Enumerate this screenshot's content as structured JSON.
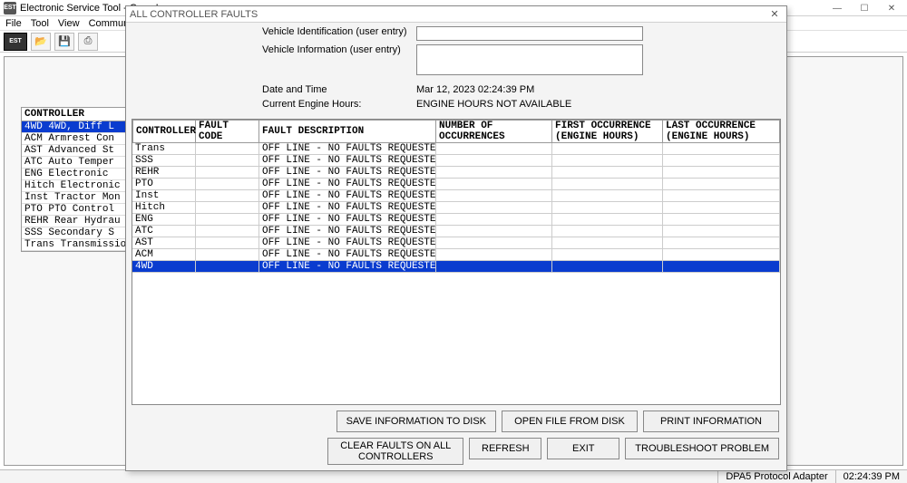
{
  "mainWindow": {
    "title": "Electronic Service Tool - Case I",
    "appIconLabel": "EST",
    "menu": [
      "File",
      "Tool",
      "View",
      "Communicati"
    ],
    "sysButtons": {
      "min": "—",
      "max": "☐",
      "close": "✕"
    },
    "toolbar": {
      "estLabel": "EST",
      "openIcon": "📂",
      "saveIcon": "💾",
      "printIcon": "⎙"
    }
  },
  "controllerList": {
    "header": "CONTROLLER",
    "rows": [
      {
        "text": "4WD   4WD, Diff L",
        "selected": true
      },
      {
        "text": "ACM   Armrest Con",
        "selected": false
      },
      {
        "text": "AST   Advanced St",
        "selected": false
      },
      {
        "text": "ATC   Auto Temper",
        "selected": false
      },
      {
        "text": "ENG   Electronic ",
        "selected": false
      },
      {
        "text": "Hitch Electronic ",
        "selected": false
      },
      {
        "text": "Inst  Tractor Mon",
        "selected": false
      },
      {
        "text": "PTO   PTO Control",
        "selected": false
      },
      {
        "text": "REHR  Rear Hydrau",
        "selected": false
      },
      {
        "text": "SSS   Secondary S",
        "selected": false
      },
      {
        "text": "Trans Transmissio",
        "selected": false
      }
    ]
  },
  "statusBar": {
    "adapter": "DPA5 Protocol Adapter",
    "clock": "02:24:39 PM"
  },
  "dialog": {
    "title": "ALL CONTROLLER FAULTS",
    "labels": {
      "vehId": "Vehicle Identification (user entry)",
      "vehInfo": "Vehicle Information (user entry)",
      "dateTime": "Date and Time",
      "engHours": "Current Engine Hours:"
    },
    "values": {
      "vehId": "",
      "vehInfo": "",
      "dateTime": "Mar 12, 2023    02:24:39 PM",
      "engHours": "ENGINE HOURS NOT AVAILABLE"
    },
    "columns": [
      "CONTROLLER",
      "FAULT CODE",
      "FAULT DESCRIPTION",
      "NUMBER OF OCCURRENCES",
      "FIRST OCCURRENCE (ENGINE HOURS)",
      "LAST OCCURRENCE (ENGINE HOURS)"
    ],
    "rows": [
      {
        "controller": "Trans",
        "code": "",
        "desc": "OFF LINE - NO FAULTS REQUESTED",
        "num": "",
        "first": "",
        "last": "",
        "selected": false
      },
      {
        "controller": "SSS",
        "code": "",
        "desc": "OFF LINE - NO FAULTS REQUESTED",
        "num": "",
        "first": "",
        "last": "",
        "selected": false
      },
      {
        "controller": "REHR",
        "code": "",
        "desc": "OFF LINE - NO FAULTS REQUESTED",
        "num": "",
        "first": "",
        "last": "",
        "selected": false
      },
      {
        "controller": "PTO",
        "code": "",
        "desc": "OFF LINE - NO FAULTS REQUESTED",
        "num": "",
        "first": "",
        "last": "",
        "selected": false
      },
      {
        "controller": "Inst",
        "code": "",
        "desc": "OFF LINE - NO FAULTS REQUESTED",
        "num": "",
        "first": "",
        "last": "",
        "selected": false
      },
      {
        "controller": "Hitch",
        "code": "",
        "desc": "OFF LINE - NO FAULTS REQUESTED",
        "num": "",
        "first": "",
        "last": "",
        "selected": false
      },
      {
        "controller": "ENG",
        "code": "",
        "desc": "OFF LINE - NO FAULTS REQUESTED",
        "num": "",
        "first": "",
        "last": "",
        "selected": false
      },
      {
        "controller": "ATC",
        "code": "",
        "desc": "OFF LINE - NO FAULTS REQUESTED",
        "num": "",
        "first": "",
        "last": "",
        "selected": false
      },
      {
        "controller": "AST",
        "code": "",
        "desc": "OFF LINE - NO FAULTS REQUESTED",
        "num": "",
        "first": "",
        "last": "",
        "selected": false
      },
      {
        "controller": "ACM",
        "code": "",
        "desc": "OFF LINE - NO FAULTS REQUESTED",
        "num": "",
        "first": "",
        "last": "",
        "selected": false
      },
      {
        "controller": "4WD",
        "code": "",
        "desc": "OFF LINE - NO FAULTS REQUESTED",
        "num": "",
        "first": "",
        "last": "",
        "selected": true
      }
    ],
    "buttons": {
      "saveDisk": "SAVE INFORMATION TO DISK",
      "openDisk": "OPEN FILE FROM DISK",
      "print": "PRINT INFORMATION",
      "clearAll": "CLEAR FAULTS ON ALL\nCONTROLLERS",
      "refresh": "REFRESH",
      "exit": "EXIT",
      "troubleshoot": "TROUBLESHOOT PROBLEM"
    }
  }
}
